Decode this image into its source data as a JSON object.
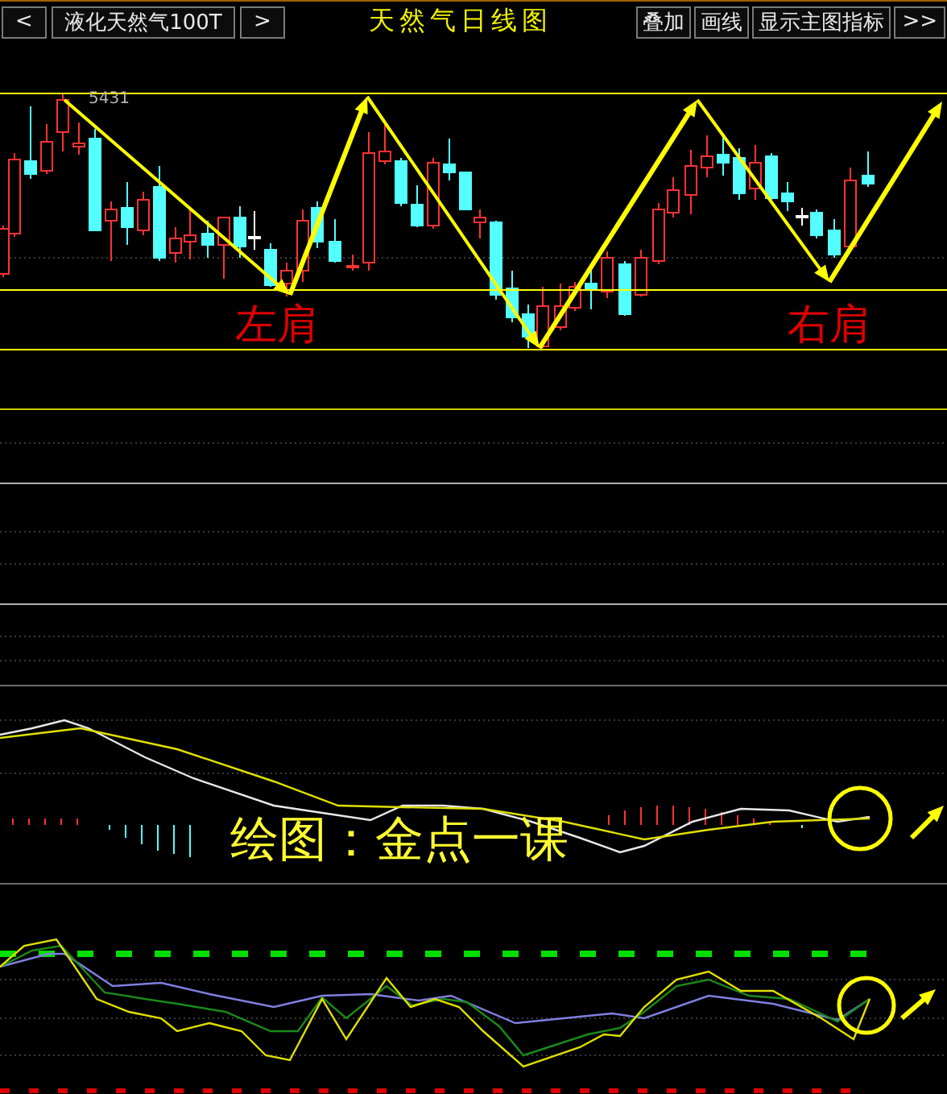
{
  "toolbar": {
    "prev": "<",
    "symbol": "液化天然气100T",
    "next": ">",
    "title": "天然气日线图",
    "buttons": [
      "叠加",
      "画线",
      "显示主图指标"
    ],
    "more": ">>"
  },
  "price_chart": {
    "high_label": "5431",
    "shoulders": [
      {
        "text": "左肩"
      },
      {
        "text": "右肩"
      }
    ]
  },
  "macd_panel": {
    "caption": "绘图：金点一课"
  }
}
